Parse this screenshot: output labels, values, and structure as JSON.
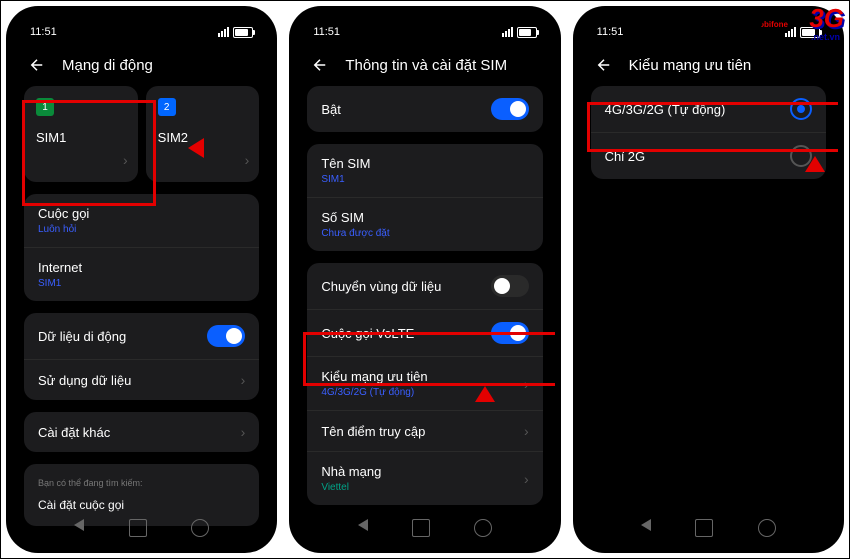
{
  "status": {
    "time": "11:51"
  },
  "screen1": {
    "title": "Mạng di động",
    "sim1": {
      "num": "1",
      "name": "SIM1"
    },
    "sim2": {
      "num": "2",
      "name": "SIM2"
    },
    "call": {
      "label": "Cuộc gọi",
      "sub": "Luôn hỏi"
    },
    "internet": {
      "label": "Internet",
      "sub": "SIM1"
    },
    "mobiledata": "Dữ liệu di động",
    "datausage": "Sử dụng dữ liệu",
    "other": "Cài đặt khác",
    "hint": {
      "label": "Bạn có thể đang tìm kiếm:",
      "text": "Cài đặt cuộc gọi"
    }
  },
  "screen2": {
    "title": "Thông tin và cài đặt SIM",
    "enable": "Bật",
    "simname": {
      "label": "Tên SIM",
      "sub": "SIM1"
    },
    "simnum": {
      "label": "Số SIM",
      "sub": "Chưa được đặt"
    },
    "roaming": "Chuyển vùng dữ liệu",
    "volte": "Cuộc gọi VoLTE",
    "nettype": {
      "label": "Kiểu mạng ưu tiên",
      "sub": "4G/3G/2G (Tự động)"
    },
    "apn": "Tên điểm truy cập",
    "carrier": {
      "label": "Nhà mạng",
      "sub": "Viettel"
    }
  },
  "screen3": {
    "title": "Kiểu mạng ưu tiên",
    "opt1": "4G/3G/2G (Tự động)",
    "opt2": "Chỉ 2G"
  }
}
